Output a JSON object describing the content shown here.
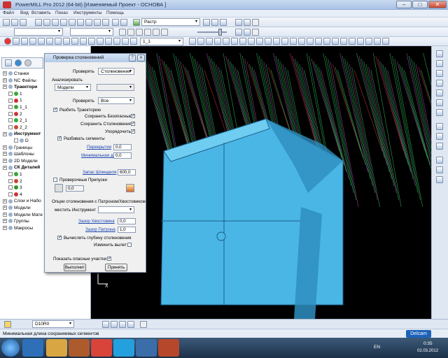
{
  "window": {
    "title": "PowerMILL Pro 2012 (64-bit)   [Изменяемый Проект - ОСНОВА ]"
  },
  "menu": [
    "Файл",
    "Вид",
    "Вставить",
    "Показ",
    "Инструменты",
    "Помощь"
  ],
  "toolbar": {
    "raster_combo": "Растр",
    "level_combo": "1_1"
  },
  "explorer": {
    "items": [
      {
        "label": "Станки",
        "lv": 1
      },
      {
        "label": "NC Файлы",
        "lv": 1
      },
      {
        "label": "Траектори",
        "lv": 1,
        "bold": true
      },
      {
        "label": "1",
        "lv": 2
      },
      {
        "label": "1",
        "lv": 2
      },
      {
        "label": "1_1",
        "lv": 2
      },
      {
        "label": "2",
        "lv": 2
      },
      {
        "label": "2_1",
        "lv": 2
      },
      {
        "label": "2_2",
        "lv": 2
      },
      {
        "label": "Инструмент",
        "lv": 1,
        "bold": true
      },
      {
        "label": "D",
        "lv": 3
      },
      {
        "label": "Границы",
        "lv": 1
      },
      {
        "label": "Шаблоны",
        "lv": 1
      },
      {
        "label": "2D Модели",
        "lv": 1
      },
      {
        "label": "СК Деталей",
        "lv": 1,
        "bold": true
      },
      {
        "label": "1",
        "lv": 2
      },
      {
        "label": "2",
        "lv": 2
      },
      {
        "label": "3",
        "lv": 2
      },
      {
        "label": "4",
        "lv": 2
      },
      {
        "label": "Слои и Набо",
        "lv": 1
      },
      {
        "label": "Модели",
        "lv": 1
      },
      {
        "label": "Модели Мате",
        "lv": 1
      },
      {
        "label": "Группы",
        "lv": 1
      },
      {
        "label": "Макросы",
        "lv": 1
      }
    ]
  },
  "dialog": {
    "title": "Проверка столкновений",
    "check_label": "Проверять",
    "check_value": "Столкновения",
    "analyze_label": "Анализировать",
    "analyze_value": "Модели",
    "analyze_second": "",
    "check2_label": "Проверять",
    "check2_value": "Все",
    "split_label": "Разбить Траекторию",
    "keep_safe_label": "Сохранить Безопасные",
    "keep_collisions_label": "Сохранить Столкновения",
    "order_label": "Упорядочить",
    "split_segments_label": "Разбивать сегменты",
    "overlap_label": "Перекрытия",
    "overlap_value": "0,0",
    "min_length_label": "Минимальная длина",
    "min_length_value": "0,0",
    "spindle_label": "Запас Шпинделя",
    "spindle_value": "600,0",
    "check_allowances_label": "Проверочные Припуски",
    "allowance_value": "0,0",
    "holder_group": "Опции столкновения с Патроном/Хвостовиком",
    "place_tool_label": "местить Инструмент",
    "place_tool_value": "",
    "shank_label": "Зазор Хвостовика",
    "shank_value": "0,0",
    "holder_label": "Зазор Патрона",
    "holder_value": "1,0",
    "depth_label": "Вычислить глубину столкновения",
    "change_overhang_label": "Изменить вылет",
    "show_unsafe_label": "Показать опасные участки",
    "apply_button": "Выполнит",
    "accept_button": "Принять"
  },
  "bottom": {
    "tool_combo": "D10R0"
  },
  "status": {
    "text": "Минимальная длина сохраняемых сегментов"
  },
  "tray": {
    "lang": "EN",
    "time": "0:35",
    "date": "02.03.2012"
  },
  "brand": {
    "logo": "Delcam"
  },
  "colors": {
    "model": "#3fa7dc",
    "paths_green": "#3bd36a",
    "paths_pink": "#d24dd8",
    "paths_red": "#e0403a"
  }
}
